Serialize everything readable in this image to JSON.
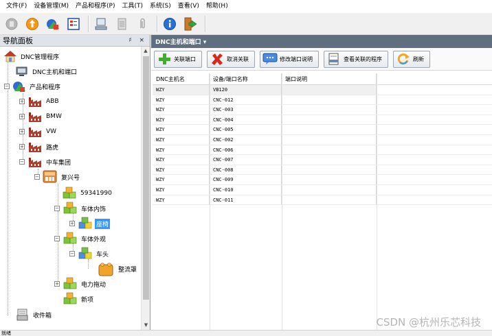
{
  "menu": [
    "文件(F)",
    "设备管理(M)",
    "产品和程序(P)",
    "工具(T)",
    "系统(S)",
    "查看(V)",
    "帮助(H)"
  ],
  "nav": {
    "title": "导航面板",
    "pin": "♯ ×",
    "tree": [
      {
        "label": "DNC管理程序",
        "icon": "house-icon"
      },
      {
        "label": "DNC主机和端口",
        "icon": "monitor-icon"
      },
      {
        "label": "产品和程序",
        "icon": "shapes-icon"
      },
      {
        "label": "ABB",
        "icon": "factory-icon"
      },
      {
        "label": "BMW",
        "icon": "factory-icon"
      },
      {
        "label": "VW",
        "icon": "factory-icon"
      },
      {
        "label": "路虎",
        "icon": "factory-icon"
      },
      {
        "label": "中车集团",
        "icon": "factory-icon"
      },
      {
        "label": "复兴号",
        "icon": "product-box-icon"
      },
      {
        "label": "59341990",
        "icon": "green-cubes-icon"
      },
      {
        "label": "车体内饰",
        "icon": "green-cubes-icon"
      },
      {
        "label": "座椅",
        "icon": "blue-cubes-icon"
      },
      {
        "label": "车体外观",
        "icon": "green-cubes-icon"
      },
      {
        "label": "车头",
        "icon": "blue-cubes-icon"
      },
      {
        "label": "整流罩",
        "icon": "orange-block-icon"
      },
      {
        "label": "电力拖动",
        "icon": "green-cubes-icon"
      },
      {
        "label": "新项",
        "icon": "green-cubes-icon"
      },
      {
        "label": "收件箱",
        "icon": "inbox-icon"
      }
    ]
  },
  "panel": {
    "title": "DNC主机和端口 ▾",
    "buttons": [
      "关联端口",
      "取消关联",
      "修改端口说明",
      "查看关联的程序",
      "刷新"
    ],
    "columns": [
      "DNC主机名",
      "设备/端口名称",
      "端口说明"
    ],
    "rows": [
      [
        "WZY",
        "VB120",
        ""
      ],
      [
        "WZY",
        "CNC-012",
        ""
      ],
      [
        "WZY",
        "CNC-003",
        ""
      ],
      [
        "WZY",
        "CNC-004",
        ""
      ],
      [
        "WZY",
        "CNC-005",
        ""
      ],
      [
        "WZY",
        "CNC-002",
        ""
      ],
      [
        "WZY",
        "CNC-006",
        ""
      ],
      [
        "WZY",
        "CNC-007",
        ""
      ],
      [
        "WZY",
        "CNC-008",
        ""
      ],
      [
        "WZY",
        "CNC-009",
        ""
      ],
      [
        "WZY",
        "CNC-010",
        ""
      ],
      [
        "WZY",
        "CNC-011",
        ""
      ]
    ]
  },
  "status": "就绪",
  "watermark": "CSDN @杭州乐芯科技"
}
